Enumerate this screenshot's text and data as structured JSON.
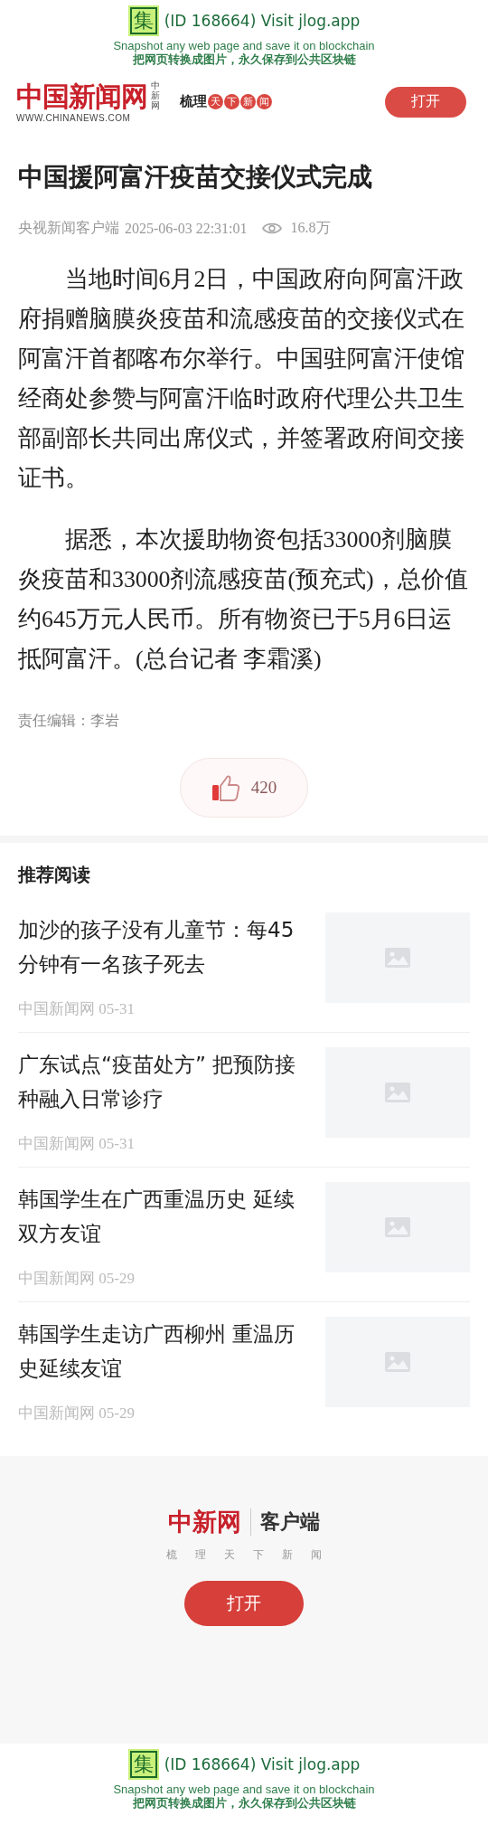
{
  "banner_top": {
    "badge": "集",
    "id_text": "(ID 168664) Visit jlog.app",
    "tagline": "Snapshot any web page and save it on blockchain",
    "tagline_zh": "把网页转换成图片，永久保存到公共区块链"
  },
  "header": {
    "logo": "中国新闻网",
    "logo_side": "中新网",
    "domain": "WWW.CHINANEWS.COM",
    "slogan_a": "梳理",
    "slogan_b": "天下新闻",
    "open_button": "打开"
  },
  "article": {
    "title": "中国援阿富汗疫苗交接仪式完成",
    "source": "央视新闻客户端",
    "time": "2025-06-03 22:31:01",
    "views": "16.8万",
    "paragraphs": [
      "当地时间6月2日，中国政府向阿富汗政府捐赠脑膜炎疫苗和流感疫苗的交接仪式在阿富汗首都喀布尔举行。中国驻阿富汗使馆经商处参赞与阿富汗临时政府代理公共卫生部副部长共同出席仪式，并签署政府间交接证书。",
      "据悉，本次援助物资包括33000剂脑膜炎疫苗和33000剂流感疫苗(预充式)，总价值约645万元人民币。所有物资已于5月6日运抵阿富汗。(总台记者 李霜溪)"
    ],
    "editor": "责任编辑：李岩",
    "likes": "420"
  },
  "recommended": {
    "heading": "推荐阅读",
    "items": [
      {
        "title": "加沙的孩子没有儿童节：每45分钟有一名孩子死去",
        "source": "中国新闻网",
        "date": "05-31"
      },
      {
        "title": "广东试点“疫苗处方” 把预防接种融入日常诊疗",
        "source": "中国新闻网",
        "date": "05-31"
      },
      {
        "title": "韩国学生在广西重温历史 延续双方友谊",
        "source": "中国新闻网",
        "date": "05-29"
      },
      {
        "title": "韩国学生走访广西柳州 重温历史延续友谊",
        "source": "中国新闻网",
        "date": "05-29"
      }
    ]
  },
  "app_promo": {
    "logo": "中新网",
    "label": "客户端",
    "slogan": "梳理天下新闻",
    "open_button": "打开"
  },
  "banner_bottom": {
    "badge": "集",
    "id_text": "(ID 168664) Visit jlog.app",
    "tagline": "Snapshot any web page and save it on blockchain",
    "tagline_zh": "把网页转换成图片，永久保存到公共区块链"
  }
}
